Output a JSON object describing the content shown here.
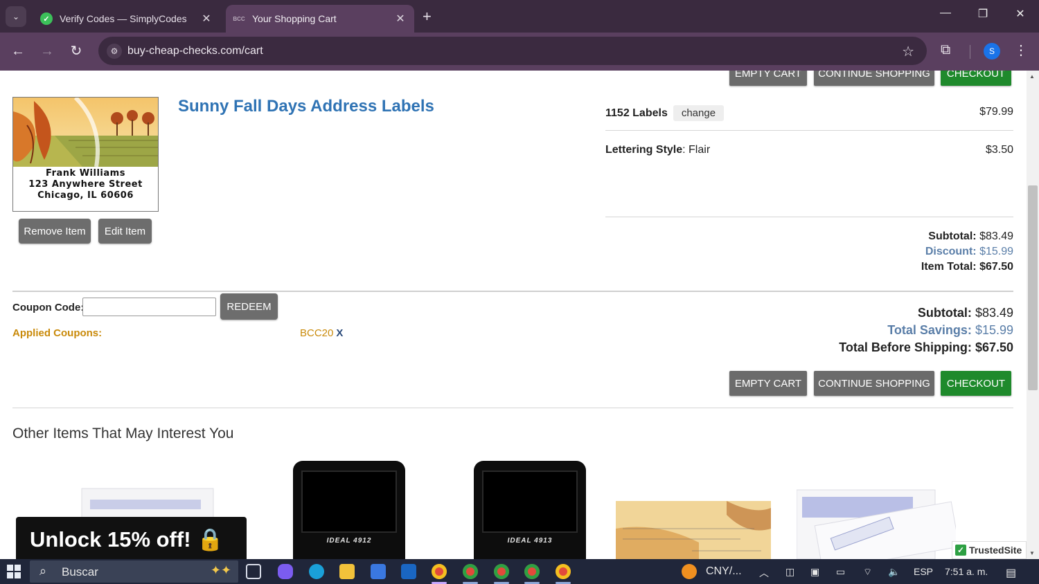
{
  "browser": {
    "tabs": [
      {
        "title": "Verify Codes — SimplyCodes",
        "favicon_icon": "simplycodes-icon"
      },
      {
        "title": "Your Shopping Cart",
        "favicon_text": "BCC"
      }
    ],
    "new_tab": "+",
    "url": "buy-cheap-checks.com/cart",
    "profile_initial": "S"
  },
  "top_buttons": {
    "empty_cart": "EMPTY CART",
    "continue_shopping": "CONTINUE SHOPPING",
    "checkout": "CHECKOUT"
  },
  "product": {
    "title": "Sunny Fall Days Address Labels",
    "label_lines": [
      "Frank Williams",
      "123 Anywhere Street",
      "Chicago, IL 60606"
    ],
    "remove_label": "Remove Item",
    "edit_label": "Edit Item",
    "options": [
      {
        "name": "1152 Labels",
        "action": "change",
        "price": "$79.99"
      },
      {
        "name": "Lettering Style",
        "value": "Flair",
        "price": "$3.50"
      }
    ],
    "subtotal_label": "Subtotal:",
    "subtotal": "$83.49",
    "discount_label": "Discount:",
    "discount": "$15.99",
    "item_total_label": "Item Total:",
    "item_total": "$67.50"
  },
  "coupon": {
    "label": "Coupon Code:",
    "value": "",
    "redeem": "REDEEM",
    "applied_label": "Applied Coupons:",
    "applied_code": "BCC20",
    "remove": "X"
  },
  "totals": {
    "subtotal_label": "Subtotal:",
    "subtotal": "$83.49",
    "savings_label": "Total Savings:",
    "savings": "$15.99",
    "before_ship_label": "Total Before Shipping:",
    "before_ship": "$67.50"
  },
  "bottom_buttons": {
    "empty_cart": "EMPTY CART",
    "continue_shopping": "CONTINUE SHOPPING",
    "checkout": "CHECKOUT"
  },
  "other_items": {
    "title": "Other Items That May Interest You",
    "stamp1_brand": "IDEAL 4912",
    "stamp2_brand": "IDEAL 4913"
  },
  "promo": {
    "text": "Unlock 15% off!"
  },
  "trusted": {
    "text": "TrustedSite"
  },
  "taskbar": {
    "search_placeholder": "Buscar",
    "currency": "CNY/...",
    "lang": "ESP",
    "time": "7:51 a. m."
  },
  "colors": {
    "title_blue": "#2f73b4",
    "checkout_green": "#1f8a2c",
    "discount_blue": "#5a7ea8",
    "coupon_gold": "#c98a0a"
  }
}
